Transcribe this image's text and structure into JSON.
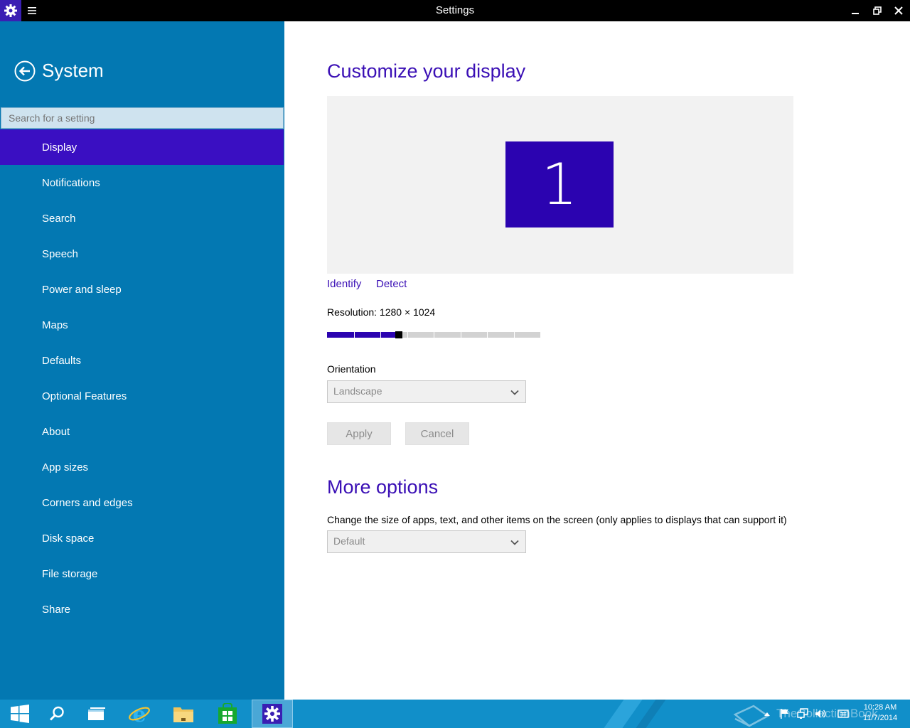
{
  "window": {
    "title": "Settings"
  },
  "sidebar": {
    "section_title": "System",
    "search_placeholder": "Search for a setting",
    "items": [
      {
        "label": "Display",
        "selected": true
      },
      {
        "label": "Notifications"
      },
      {
        "label": "Search"
      },
      {
        "label": "Speech"
      },
      {
        "label": "Power and sleep"
      },
      {
        "label": "Maps"
      },
      {
        "label": "Defaults"
      },
      {
        "label": "Optional Features"
      },
      {
        "label": "About"
      },
      {
        "label": "App sizes"
      },
      {
        "label": "Corners and edges"
      },
      {
        "label": "Disk space"
      },
      {
        "label": "File storage"
      },
      {
        "label": "Share"
      }
    ]
  },
  "main": {
    "heading": "Customize your display",
    "monitor_number": "1",
    "identify_link": "Identify",
    "detect_link": "Detect",
    "resolution_text": "Resolution: 1280 × 1024",
    "resolution_slider": {
      "value_fraction": 0.33
    },
    "orientation_label": "Orientation",
    "orientation_value": "Landscape",
    "apply_label": "Apply",
    "cancel_label": "Cancel",
    "more_options_heading": "More options",
    "scale_description": "Change the size of apps, text, and other items on the screen (only applies to displays that can support it)",
    "scale_value": "Default"
  },
  "taskbar": {
    "apps": [
      "start",
      "search",
      "task-view",
      "internet-explorer",
      "file-explorer",
      "store",
      "settings"
    ],
    "active_app": "settings",
    "clock_time": "10:28 AM",
    "clock_date": "11/7/2014",
    "watermark_text": "TheCollectionBook"
  },
  "colors": {
    "accent": "#3a0fb5",
    "sidebar": "#0378b2",
    "selected_item": "#3a0fc2",
    "taskbar": "#118fc9",
    "monitor_tile": "#2b03b0"
  }
}
